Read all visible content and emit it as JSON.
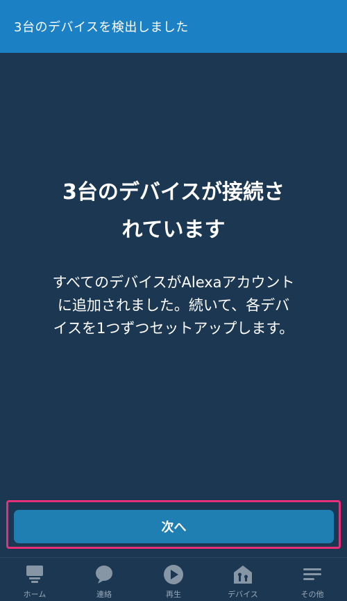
{
  "header": {
    "title": "3台のデバイスを検出しました"
  },
  "main": {
    "headline_line1": "3台のデバイスが接続さ",
    "headline_line2": "れています",
    "body_line1": "すべてのデバイスがAlexaアカウント",
    "body_line2": "に追加されました。続いて、各デバ",
    "body_line3": "イスを1つずつセットアップします。",
    "next_button": "次へ"
  },
  "tabbar": {
    "items": [
      {
        "label": "ホーム",
        "icon": "home-icon"
      },
      {
        "label": "連絡",
        "icon": "chat-bubble-icon"
      },
      {
        "label": "再生",
        "icon": "play-icon"
      },
      {
        "label": "デバイス",
        "icon": "devices-icon"
      },
      {
        "label": "その他",
        "icon": "menu-icon"
      }
    ]
  },
  "colors": {
    "header_bg": "#1b80c4",
    "page_bg": "#1b3752",
    "button_bg": "#1f7fb2",
    "highlight_border": "#e6307a",
    "tab_icon": "#8796a4"
  }
}
